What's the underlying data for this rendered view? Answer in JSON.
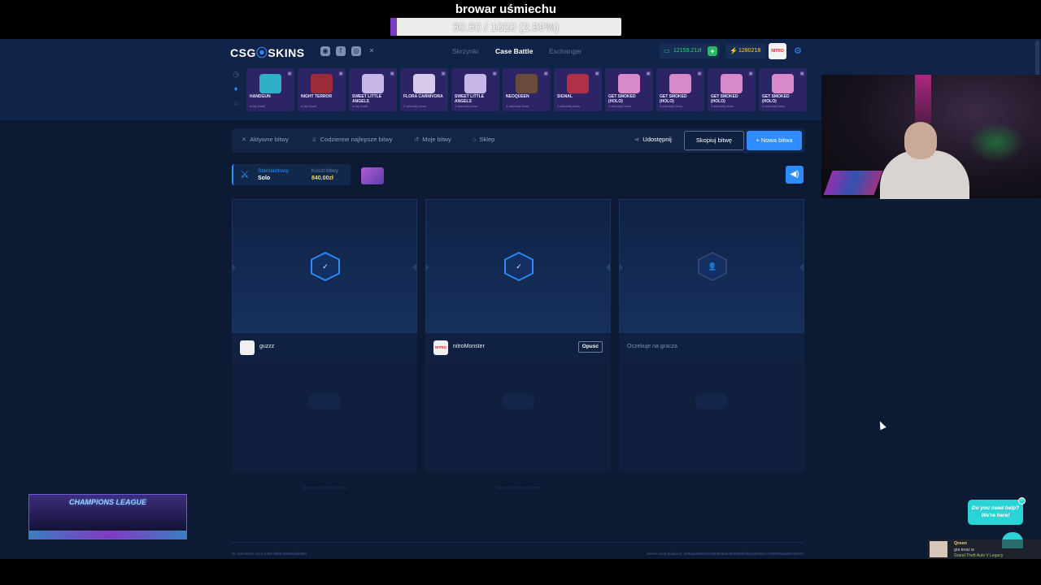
{
  "overlay": {
    "title": "browar uśmiechu",
    "progress_text": "30.50 / 1020 (2.99%)",
    "progress_fraction": 0.0299
  },
  "header": {
    "logo_left": "CSG",
    "logo_mark": "⦿",
    "logo_right": "SKINS",
    "nav": [
      "Skrzynki",
      "Case Battle",
      "Exchanger"
    ],
    "active_nav": "Case Battle",
    "balance": "12159.21zł",
    "coins": "1280218",
    "user_avatar_text": "NITRO"
  },
  "live_drops": [
    {
      "name": "HANDGUN",
      "sub": "w tej chwili",
      "color": "#2d2466",
      "art": "#2fb0c8"
    },
    {
      "name": "NIGHT TERROR",
      "sub": "w tej chwili",
      "color": "#2d2466",
      "art": "#9b2a3a"
    },
    {
      "name": "SWEET LITTLE ANGELS",
      "sub": "w tej chwili",
      "color": "#2d2466",
      "art": "#c8b6e8"
    },
    {
      "name": "FLORA CARNIVORA",
      "sub": "2 sekundy temu",
      "color": "#2d2466",
      "art": "#d8c8ec"
    },
    {
      "name": "SWEET LITTLE ANGELS",
      "sub": "3 sekundy temu",
      "color": "#2d2466",
      "art": "#c8b6e8"
    },
    {
      "name": "NEOQUEEN",
      "sub": "3 sekundy temu",
      "color": "#2d2466",
      "art": "#6a4a3a"
    },
    {
      "name": "SIGNAL",
      "sub": "3 sekundy temu",
      "color": "#2d2466",
      "art": "#b03048"
    },
    {
      "name": "GET SMOKED (HOLO)",
      "sub": "3 sekundy temu",
      "color": "#2d2466",
      "art": "#d88ac8"
    },
    {
      "name": "GET SMOKED (HOLO)",
      "sub": "3 sekundy temu",
      "color": "#2d2466",
      "art": "#d88ac8"
    },
    {
      "name": "GET SMOKED (HOLO)",
      "sub": "3 sekundy temu",
      "color": "#2d2466",
      "art": "#d88ac8"
    },
    {
      "name": "GET SMOKED (HOLO)",
      "sub": "3 sekundy temu",
      "color": "#2d2466",
      "art": "#d88ac8"
    }
  ],
  "toolbar": {
    "tabs": [
      "Aktywne bitwy",
      "Codzienne najlepsze bitwy",
      "Moje bitwy",
      "Sklep"
    ],
    "share": "Udostępnij",
    "copy": "Skopiuj bitwę",
    "new": "+ Nowa bitwa"
  },
  "battle": {
    "mode_label": "Standardowy",
    "mode_value": "Solo",
    "cost_label": "Koszt bitwy",
    "cost_value": "840.00zł"
  },
  "slots": [
    {
      "player": "guzzz",
      "state": "ready",
      "icon": "✓",
      "leave": "",
      "footer": "Nie masz jeszcze skinów"
    },
    {
      "player": "nitroMonster",
      "state": "ready",
      "icon": "✓",
      "leave": "Opuść",
      "footer": "Nie masz jeszcze skinów"
    },
    {
      "player": "",
      "state": "waiting",
      "icon": "👤",
      "leave": "",
      "waiting_text": "Oczekuje na gracza",
      "footer": ""
    }
  ],
  "footer": {
    "id": "ID: 8da42602-157a-4455-99b9-58abad9580f4",
    "seed": "Server seed (hashed): 1e9c0a4a5825e3f9b5f2b0a49d58bf5b26240fe69e72795f9f0b8abb22e674"
  },
  "stream": {
    "banner": "CHAMPIONS LEAGUE",
    "help_line1": "Do you need help?",
    "help_line2": "We're here!",
    "np_name": "Qreen",
    "np_line1": "gra teraz w",
    "np_line2": "Grand Theft Auto V Legacy"
  }
}
